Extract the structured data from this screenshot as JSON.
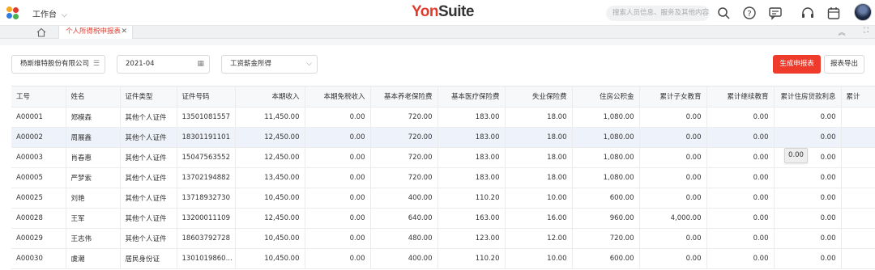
{
  "topbar": {
    "workbench_label": "工作台",
    "brand_main": "Yon",
    "brand_suffix": "Suite",
    "search_placeholder": "搜索人员信息、服务及其他内容",
    "icons": [
      "search-icon",
      "help-icon",
      "message-icon",
      "headset-icon",
      "calendar-icon"
    ]
  },
  "tabbar": {
    "active_tab": "个人所得税申报表",
    "close_glyph": "✕"
  },
  "filters": {
    "company": "杨斯维特股份有限公司",
    "period": "2021-04",
    "income_type": "工资薪金所得"
  },
  "actions": {
    "generate": "生成申报表",
    "export": "报表导出"
  },
  "table": {
    "columns": [
      "工号",
      "姓名",
      "证件类型",
      "证件号码",
      "本期收入",
      "本期免税收入",
      "基本养老保险费",
      "基本医疗保险费",
      "失业保险费",
      "住房公积金",
      "累计子女教育",
      "累计继续教育",
      "累计住房贷款利息",
      "累计"
    ],
    "rows": [
      [
        "A00001",
        "郑模森",
        "其他个人证件",
        "13501081557",
        "11,450.00",
        "0.00",
        "720.00",
        "183.00",
        "18.00",
        "1,080.00",
        "0.00",
        "0.00",
        "0.00",
        ""
      ],
      [
        "A00002",
        "周展鑫",
        "其他个人证件",
        "18301191101",
        "12,450.00",
        "0.00",
        "720.00",
        "183.00",
        "18.00",
        "1,080.00",
        "0.00",
        "0.00",
        "0.00",
        ""
      ],
      [
        "A00003",
        "肖春惠",
        "其他个人证件",
        "15047563552",
        "12,450.00",
        "0.00",
        "720.00",
        "183.00",
        "18.00",
        "1,080.00",
        "0.00",
        "0.00",
        "0.00",
        ""
      ],
      [
        "A00005",
        "严梦索",
        "其他个人证件",
        "13702194882",
        "13,450.00",
        "0.00",
        "720.00",
        "183.00",
        "18.00",
        "1,080.00",
        "0.00",
        "0.00",
        "0.00",
        ""
      ],
      [
        "A00025",
        "刘艳",
        "其他个人证件",
        "13718932730",
        "10,450.00",
        "0.00",
        "400.00",
        "110.20",
        "10.00",
        "600.00",
        "0.00",
        "0.00",
        "0.00",
        ""
      ],
      [
        "A00028",
        "王军",
        "其他个人证件",
        "13200011109",
        "12,450.00",
        "0.00",
        "640.00",
        "163.00",
        "16.00",
        "960.00",
        "4,000.00",
        "0.00",
        "0.00",
        ""
      ],
      [
        "A00029",
        "王志伟",
        "其他个人证件",
        "18603792728",
        "10,450.00",
        "0.00",
        "480.00",
        "123.00",
        "12.00",
        "720.00",
        "0.00",
        "0.00",
        "0.00",
        ""
      ],
      [
        "A00030",
        "虞潮",
        "居民身份证",
        "1301019860...",
        "10,450.00",
        "0.00",
        "400.00",
        "110.20",
        "10.00",
        "600.00",
        "0.00",
        "0.00",
        "0.00",
        ""
      ]
    ],
    "selected_row": 1
  },
  "tooltip": {
    "text": "0.00"
  },
  "colors": {
    "accent": "#ee3b2b",
    "selected_row": "#eef2fa"
  }
}
